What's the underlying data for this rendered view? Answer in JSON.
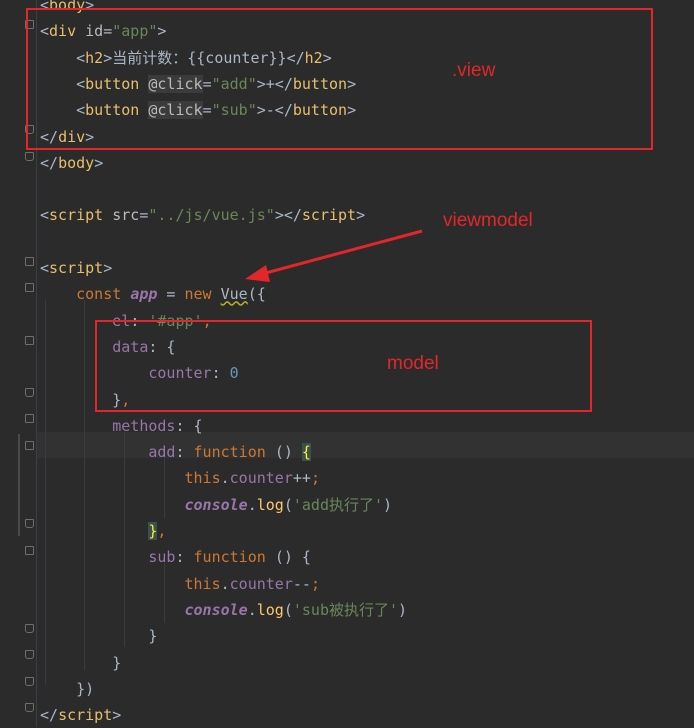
{
  "editor": {
    "lines": [
      {
        "tokens": [
          {
            "t": "<",
            "c": "plain"
          },
          {
            "t": "body",
            "c": "tag"
          },
          {
            "t": ">",
            "c": "plain"
          }
        ]
      },
      {
        "tokens": [
          {
            "t": "<",
            "c": "plain"
          },
          {
            "t": "div ",
            "c": "tag"
          },
          {
            "t": "id",
            "c": "attr"
          },
          {
            "t": "=",
            "c": "plain"
          },
          {
            "t": "\"app\"",
            "c": "str"
          },
          {
            "t": ">",
            "c": "plain"
          }
        ]
      },
      {
        "tokens": [
          {
            "t": "    <",
            "c": "plain"
          },
          {
            "t": "h2",
            "c": "tag"
          },
          {
            "t": ">当前计数：{{counter}}</",
            "c": "plain"
          },
          {
            "t": "h2",
            "c": "tag"
          },
          {
            "t": ">",
            "c": "plain"
          }
        ]
      },
      {
        "tokens": [
          {
            "t": "    <",
            "c": "plain"
          },
          {
            "t": "button ",
            "c": "tag"
          },
          {
            "t": "@click",
            "c": "attr hl-attr"
          },
          {
            "t": "=",
            "c": "plain"
          },
          {
            "t": "\"add\"",
            "c": "str"
          },
          {
            "t": ">+</",
            "c": "plain"
          },
          {
            "t": "button",
            "c": "tag"
          },
          {
            "t": ">",
            "c": "plain"
          }
        ]
      },
      {
        "tokens": [
          {
            "t": "    <",
            "c": "plain"
          },
          {
            "t": "button ",
            "c": "tag"
          },
          {
            "t": "@click",
            "c": "attr hl-attr"
          },
          {
            "t": "=",
            "c": "plain"
          },
          {
            "t": "\"sub\"",
            "c": "str"
          },
          {
            "t": ">-</",
            "c": "plain"
          },
          {
            "t": "button",
            "c": "tag"
          },
          {
            "t": ">",
            "c": "plain"
          }
        ]
      },
      {
        "tokens": [
          {
            "t": "</",
            "c": "plain"
          },
          {
            "t": "div",
            "c": "tag"
          },
          {
            "t": ">",
            "c": "plain"
          }
        ]
      },
      {
        "tokens": [
          {
            "t": "</",
            "c": "plain"
          },
          {
            "t": "body",
            "c": "tag"
          },
          {
            "t": ">",
            "c": "plain"
          }
        ]
      },
      {
        "tokens": []
      },
      {
        "tokens": [
          {
            "t": "<",
            "c": "plain"
          },
          {
            "t": "script ",
            "c": "tag"
          },
          {
            "t": "src",
            "c": "attr"
          },
          {
            "t": "=",
            "c": "plain"
          },
          {
            "t": "\"../js/vue.js\"",
            "c": "str"
          },
          {
            "t": "></",
            "c": "plain"
          },
          {
            "t": "script",
            "c": "tag"
          },
          {
            "t": ">",
            "c": "plain"
          }
        ]
      },
      {
        "tokens": []
      },
      {
        "tokens": [
          {
            "t": "<",
            "c": "plain"
          },
          {
            "t": "script",
            "c": "tag"
          },
          {
            "t": ">",
            "c": "plain"
          }
        ]
      },
      {
        "tokens": [
          {
            "t": "    const ",
            "c": "kw"
          },
          {
            "t": "app",
            "c": "glob"
          },
          {
            "t": " = ",
            "c": "plain"
          },
          {
            "t": "new ",
            "c": "kw"
          },
          {
            "t": "Vue",
            "c": "plain squiggle"
          },
          {
            "t": "({",
            "c": "plain"
          }
        ]
      },
      {
        "tokens": [
          {
            "t": "        el",
            "c": "prop"
          },
          {
            "t": ": ",
            "c": "plain"
          },
          {
            "t": "'#app'",
            "c": "str"
          },
          {
            "t": ",",
            "c": "kw"
          }
        ]
      },
      {
        "tokens": [
          {
            "t": "        data",
            "c": "prop"
          },
          {
            "t": ": {",
            "c": "plain"
          }
        ]
      },
      {
        "tokens": [
          {
            "t": "            counter",
            "c": "prop"
          },
          {
            "t": ": ",
            "c": "plain"
          },
          {
            "t": "0",
            "c": "num"
          }
        ]
      },
      {
        "tokens": [
          {
            "t": "        }",
            "c": "plain"
          },
          {
            "t": ",",
            "c": "kw"
          }
        ]
      },
      {
        "tokens": [
          {
            "t": "        methods",
            "c": "prop"
          },
          {
            "t": ": {",
            "c": "plain"
          }
        ]
      },
      {
        "tokens": [
          {
            "t": "            add",
            "c": "prop"
          },
          {
            "t": ": ",
            "c": "plain"
          },
          {
            "t": "function ",
            "c": "kw"
          },
          {
            "t": "() ",
            "c": "plain"
          },
          {
            "t": "{",
            "c": "brace-hl"
          }
        ]
      },
      {
        "tokens": [
          {
            "t": "                this",
            "c": "kw"
          },
          {
            "t": ".",
            "c": "plain"
          },
          {
            "t": "counter",
            "c": "prop"
          },
          {
            "t": "++",
            "c": "plain"
          },
          {
            "t": ";",
            "c": "kw"
          }
        ]
      },
      {
        "tokens": [
          {
            "t": "                console",
            "c": "glob"
          },
          {
            "t": ".",
            "c": "plain"
          },
          {
            "t": "log",
            "c": "fn"
          },
          {
            "t": "(",
            "c": "plain"
          },
          {
            "t": "'add执行了'",
            "c": "str"
          },
          {
            "t": ")",
            "c": "plain"
          }
        ]
      },
      {
        "tokens": [
          {
            "t": "            ",
            "c": "plain"
          },
          {
            "t": "}",
            "c": "brace-hl"
          },
          {
            "t": ",",
            "c": "kw"
          }
        ]
      },
      {
        "tokens": [
          {
            "t": "            sub",
            "c": "prop"
          },
          {
            "t": ": ",
            "c": "plain"
          },
          {
            "t": "function ",
            "c": "kw"
          },
          {
            "t": "() {",
            "c": "plain"
          }
        ]
      },
      {
        "tokens": [
          {
            "t": "                this",
            "c": "kw"
          },
          {
            "t": ".",
            "c": "plain"
          },
          {
            "t": "counter",
            "c": "prop"
          },
          {
            "t": "--",
            "c": "plain"
          },
          {
            "t": ";",
            "c": "kw"
          }
        ]
      },
      {
        "tokens": [
          {
            "t": "                console",
            "c": "glob"
          },
          {
            "t": ".",
            "c": "plain"
          },
          {
            "t": "log",
            "c": "fn"
          },
          {
            "t": "(",
            "c": "plain"
          },
          {
            "t": "'sub被执行了'",
            "c": "str"
          },
          {
            "t": ")",
            "c": "plain"
          }
        ]
      },
      {
        "tokens": [
          {
            "t": "            }",
            "c": "plain"
          }
        ]
      },
      {
        "tokens": [
          {
            "t": "        }",
            "c": "plain"
          }
        ]
      },
      {
        "tokens": [
          {
            "t": "    })",
            "c": "plain"
          }
        ]
      },
      {
        "tokens": [
          {
            "t": "</",
            "c": "plain"
          },
          {
            "t": "script",
            "c": "tag"
          },
          {
            "t": ">",
            "c": "plain"
          }
        ]
      }
    ]
  },
  "annotations": {
    "view": ".view",
    "viewmodel": "viewmodel",
    "model": "model"
  },
  "colors": {
    "background": "#2b2b2b",
    "annotation_red": "#e3262a",
    "tag": "#e8bf6a",
    "string": "#6a8759",
    "keyword": "#cc7832",
    "property": "#9876aa",
    "number": "#6897bb",
    "function": "#ffc66d"
  }
}
